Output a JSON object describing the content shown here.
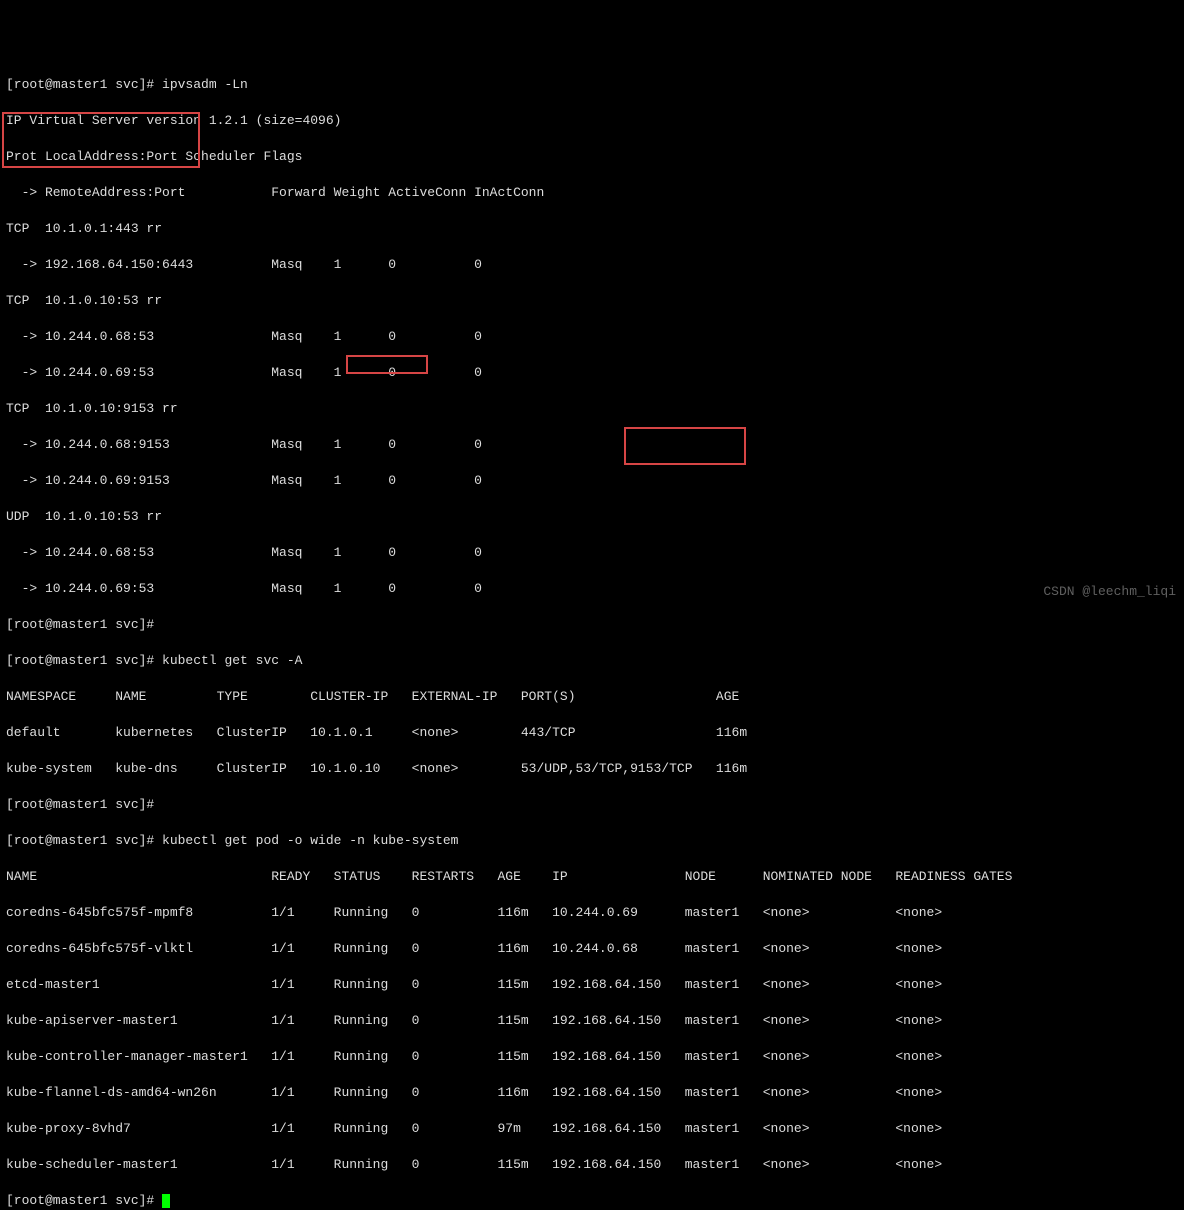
{
  "prompt1": "[root@master1 svc]# ",
  "cmd1": "ipvsadm -Ln",
  "ipvs": {
    "header1": "IP Virtual Server version 1.2.1 (size=4096)",
    "header2": "Prot LocalAddress:Port Scheduler Flags",
    "header3": "  -> RemoteAddress:Port           Forward Weight ActiveConn InActConn",
    "l1": "TCP  10.1.0.1:443 rr",
    "l2": "  -> 192.168.64.150:6443          Masq    1      0          0",
    "l3": "TCP  10.1.0.10:53 rr",
    "l4": "  -> 10.244.0.68:53               Masq    1      0          0",
    "l5": "  -> 10.244.0.69:53               Masq    1      0          0",
    "l6": "TCP  10.1.0.10:9153 rr",
    "l7": "  -> 10.244.0.68:9153             Masq    1      0          0",
    "l8": "  -> 10.244.0.69:9153             Masq    1      0          0",
    "l9": "UDP  10.1.0.10:53 rr",
    "l10": "  -> 10.244.0.68:53               Masq    1      0          0",
    "l11": "  -> 10.244.0.69:53               Masq    1      0          0"
  },
  "prompt2": "[root@master1 svc]#",
  "prompt3": "[root@master1 svc]# ",
  "cmd2": "kubectl get svc -A",
  "svc": {
    "hdr": "NAMESPACE     NAME         TYPE        CLUSTER-IP   EXTERNAL-IP   PORT(S)                  AGE",
    "r1": "default       kubernetes   ClusterIP   10.1.0.1     <none>        443/TCP                  116m",
    "r2": "kube-system   kube-dns     ClusterIP   10.1.0.10    <none>        53/UDP,53/TCP,9153/TCP   116m"
  },
  "prompt4": "[root@master1 svc]#",
  "prompt5": "[root@master1 svc]# ",
  "cmd3": "kubectl get pod -o wide -n kube-system",
  "pod": {
    "hdr": "NAME                              READY   STATUS    RESTARTS   AGE    IP               NODE      NOMINATED NODE   READINESS GATES",
    "r1": "coredns-645bfc575f-mpmf8          1/1     Running   0          116m   10.244.0.69      master1   <none>           <none>",
    "r2": "coredns-645bfc575f-vlktl          1/1     Running   0          116m   10.244.0.68      master1   <none>           <none>",
    "r3": "etcd-master1                      1/1     Running   0          115m   192.168.64.150   master1   <none>           <none>",
    "r4": "kube-apiserver-master1            1/1     Running   0          115m   192.168.64.150   master1   <none>           <none>",
    "r5": "kube-controller-manager-master1   1/1     Running   0          115m   192.168.64.150   master1   <none>           <none>",
    "r6": "kube-flannel-ds-amd64-wn26n       1/1     Running   0          116m   192.168.64.150   master1   <none>           <none>",
    "r7": "kube-proxy-8vhd7                  1/1     Running   0          97m    192.168.64.150   master1   <none>           <none>",
    "r8": "kube-scheduler-master1            1/1     Running   0          115m   192.168.64.150   master1   <none>           <none>"
  },
  "prompt6": "[root@master1 svc]# ",
  "watermark": "CSDN @leechm_liqi"
}
